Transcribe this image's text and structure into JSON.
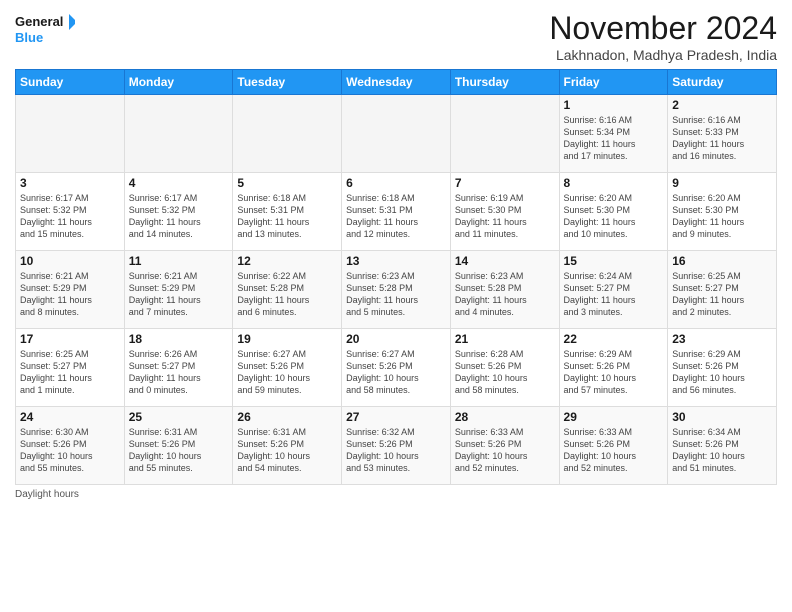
{
  "logo": {
    "line1": "General",
    "line2": "Blue"
  },
  "title": "November 2024",
  "location": "Lakhnadon, Madhya Pradesh, India",
  "days_of_week": [
    "Sunday",
    "Monday",
    "Tuesday",
    "Wednesday",
    "Thursday",
    "Friday",
    "Saturday"
  ],
  "footer": "Daylight hours",
  "weeks": [
    [
      {
        "num": "",
        "info": ""
      },
      {
        "num": "",
        "info": ""
      },
      {
        "num": "",
        "info": ""
      },
      {
        "num": "",
        "info": ""
      },
      {
        "num": "",
        "info": ""
      },
      {
        "num": "1",
        "info": "Sunrise: 6:16 AM\nSunset: 5:34 PM\nDaylight: 11 hours\nand 17 minutes."
      },
      {
        "num": "2",
        "info": "Sunrise: 6:16 AM\nSunset: 5:33 PM\nDaylight: 11 hours\nand 16 minutes."
      }
    ],
    [
      {
        "num": "3",
        "info": "Sunrise: 6:17 AM\nSunset: 5:32 PM\nDaylight: 11 hours\nand 15 minutes."
      },
      {
        "num": "4",
        "info": "Sunrise: 6:17 AM\nSunset: 5:32 PM\nDaylight: 11 hours\nand 14 minutes."
      },
      {
        "num": "5",
        "info": "Sunrise: 6:18 AM\nSunset: 5:31 PM\nDaylight: 11 hours\nand 13 minutes."
      },
      {
        "num": "6",
        "info": "Sunrise: 6:18 AM\nSunset: 5:31 PM\nDaylight: 11 hours\nand 12 minutes."
      },
      {
        "num": "7",
        "info": "Sunrise: 6:19 AM\nSunset: 5:30 PM\nDaylight: 11 hours\nand 11 minutes."
      },
      {
        "num": "8",
        "info": "Sunrise: 6:20 AM\nSunset: 5:30 PM\nDaylight: 11 hours\nand 10 minutes."
      },
      {
        "num": "9",
        "info": "Sunrise: 6:20 AM\nSunset: 5:30 PM\nDaylight: 11 hours\nand 9 minutes."
      }
    ],
    [
      {
        "num": "10",
        "info": "Sunrise: 6:21 AM\nSunset: 5:29 PM\nDaylight: 11 hours\nand 8 minutes."
      },
      {
        "num": "11",
        "info": "Sunrise: 6:21 AM\nSunset: 5:29 PM\nDaylight: 11 hours\nand 7 minutes."
      },
      {
        "num": "12",
        "info": "Sunrise: 6:22 AM\nSunset: 5:28 PM\nDaylight: 11 hours\nand 6 minutes."
      },
      {
        "num": "13",
        "info": "Sunrise: 6:23 AM\nSunset: 5:28 PM\nDaylight: 11 hours\nand 5 minutes."
      },
      {
        "num": "14",
        "info": "Sunrise: 6:23 AM\nSunset: 5:28 PM\nDaylight: 11 hours\nand 4 minutes."
      },
      {
        "num": "15",
        "info": "Sunrise: 6:24 AM\nSunset: 5:27 PM\nDaylight: 11 hours\nand 3 minutes."
      },
      {
        "num": "16",
        "info": "Sunrise: 6:25 AM\nSunset: 5:27 PM\nDaylight: 11 hours\nand 2 minutes."
      }
    ],
    [
      {
        "num": "17",
        "info": "Sunrise: 6:25 AM\nSunset: 5:27 PM\nDaylight: 11 hours\nand 1 minute."
      },
      {
        "num": "18",
        "info": "Sunrise: 6:26 AM\nSunset: 5:27 PM\nDaylight: 11 hours\nand 0 minutes."
      },
      {
        "num": "19",
        "info": "Sunrise: 6:27 AM\nSunset: 5:26 PM\nDaylight: 10 hours\nand 59 minutes."
      },
      {
        "num": "20",
        "info": "Sunrise: 6:27 AM\nSunset: 5:26 PM\nDaylight: 10 hours\nand 58 minutes."
      },
      {
        "num": "21",
        "info": "Sunrise: 6:28 AM\nSunset: 5:26 PM\nDaylight: 10 hours\nand 58 minutes."
      },
      {
        "num": "22",
        "info": "Sunrise: 6:29 AM\nSunset: 5:26 PM\nDaylight: 10 hours\nand 57 minutes."
      },
      {
        "num": "23",
        "info": "Sunrise: 6:29 AM\nSunset: 5:26 PM\nDaylight: 10 hours\nand 56 minutes."
      }
    ],
    [
      {
        "num": "24",
        "info": "Sunrise: 6:30 AM\nSunset: 5:26 PM\nDaylight: 10 hours\nand 55 minutes."
      },
      {
        "num": "25",
        "info": "Sunrise: 6:31 AM\nSunset: 5:26 PM\nDaylight: 10 hours\nand 55 minutes."
      },
      {
        "num": "26",
        "info": "Sunrise: 6:31 AM\nSunset: 5:26 PM\nDaylight: 10 hours\nand 54 minutes."
      },
      {
        "num": "27",
        "info": "Sunrise: 6:32 AM\nSunset: 5:26 PM\nDaylight: 10 hours\nand 53 minutes."
      },
      {
        "num": "28",
        "info": "Sunrise: 6:33 AM\nSunset: 5:26 PM\nDaylight: 10 hours\nand 52 minutes."
      },
      {
        "num": "29",
        "info": "Sunrise: 6:33 AM\nSunset: 5:26 PM\nDaylight: 10 hours\nand 52 minutes."
      },
      {
        "num": "30",
        "info": "Sunrise: 6:34 AM\nSunset: 5:26 PM\nDaylight: 10 hours\nand 51 minutes."
      }
    ]
  ]
}
